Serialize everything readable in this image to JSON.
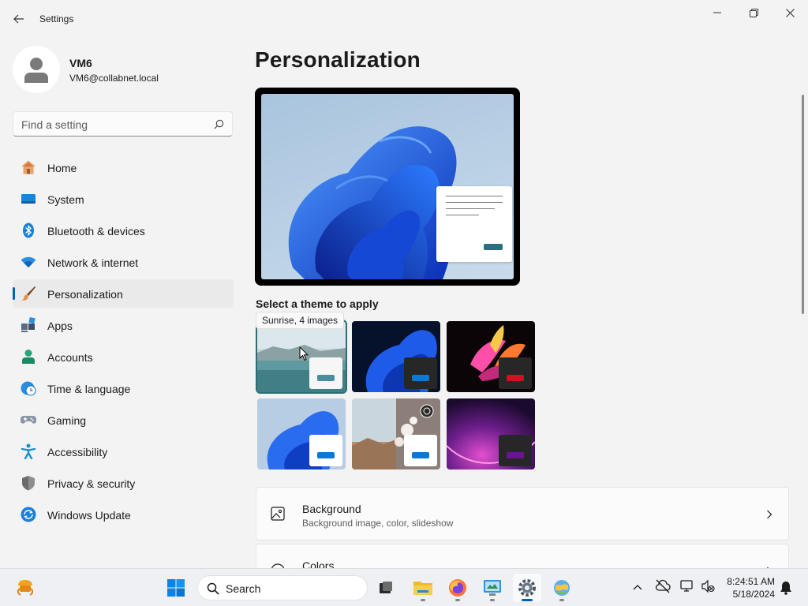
{
  "window": {
    "title": "Settings"
  },
  "profile": {
    "name": "VM6",
    "email": "VM6@collabnet.local"
  },
  "search": {
    "placeholder": "Find a setting"
  },
  "sidebar": {
    "items": [
      {
        "label": "Home",
        "icon": "home-icon"
      },
      {
        "label": "System",
        "icon": "system-icon"
      },
      {
        "label": "Bluetooth & devices",
        "icon": "bluetooth-icon"
      },
      {
        "label": "Network & internet",
        "icon": "wifi-icon"
      },
      {
        "label": "Personalization",
        "icon": "paintbrush-icon",
        "selected": true
      },
      {
        "label": "Apps",
        "icon": "apps-icon"
      },
      {
        "label": "Accounts",
        "icon": "accounts-icon"
      },
      {
        "label": "Time & language",
        "icon": "clock-globe-icon"
      },
      {
        "label": "Gaming",
        "icon": "gamepad-icon"
      },
      {
        "label": "Accessibility",
        "icon": "accessibility-icon"
      },
      {
        "label": "Privacy & security",
        "icon": "shield-icon"
      },
      {
        "label": "Windows Update",
        "icon": "update-icon"
      }
    ]
  },
  "main": {
    "title": "Personalization",
    "theme_section_label": "Select a theme to apply",
    "tooltip": "Sunrise, 4 images",
    "themes": [
      {
        "name": "sunrise",
        "selected": true,
        "accent": "#4a8e9e"
      },
      {
        "name": "windows-dark-bloom",
        "accent": "#0a78d4"
      },
      {
        "name": "glow",
        "accent": "#d01020"
      },
      {
        "name": "windows-light",
        "accent": "#0a78d4"
      },
      {
        "name": "flow",
        "accent": "#0a78d4"
      },
      {
        "name": "captured-motion",
        "accent": "#6a1490"
      }
    ],
    "cards": [
      {
        "title": "Background",
        "subtitle": "Background image, color, slideshow",
        "icon": "image-icon"
      },
      {
        "title": "Colors",
        "subtitle": "",
        "icon": "palette-icon"
      }
    ]
  },
  "taskbar": {
    "search_label": "Search",
    "time": "8:24:51 AM",
    "date": "5/18/2024"
  },
  "colors": {
    "accent": "#005fb8",
    "background": "#f3f3f3"
  }
}
